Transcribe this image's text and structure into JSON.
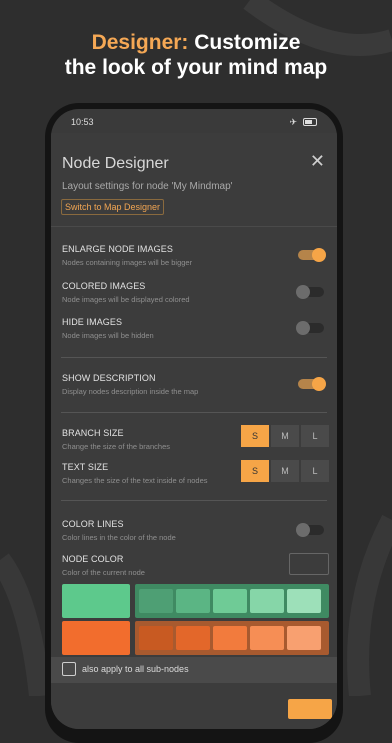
{
  "headline": {
    "accent": "Designer:",
    "line1_rest": " Customize",
    "line2": "the look of your mind map"
  },
  "status": {
    "time": "10:53",
    "airplane_icon": "airplane-icon",
    "battery_icon": "battery-icon"
  },
  "dialog": {
    "title": "Node Designer",
    "subtitle": "Layout settings for node 'My Mindmap'",
    "switch_button": "Switch to Map Designer",
    "close_icon": "close-icon"
  },
  "settings": {
    "enlarge": {
      "label": "ENLARGE NODE IMAGES",
      "desc": "Nodes containing images will be bigger",
      "on": true
    },
    "colored": {
      "label": "COLORED IMAGES",
      "desc": "Node images will be displayed colored",
      "on": false
    },
    "hide": {
      "label": "HIDE IMAGES",
      "desc": "Node images will be hidden",
      "on": false
    },
    "description": {
      "label": "SHOW DESCRIPTION",
      "desc": "Display nodes description inside the map",
      "on": true
    },
    "branch": {
      "label": "BRANCH SIZE",
      "desc": "Change the size of the branches",
      "options": [
        "S",
        "M",
        "L"
      ],
      "selected": "S"
    },
    "text": {
      "label": "TEXT SIZE",
      "desc": "Changes the size of the text inside of nodes",
      "options": [
        "S",
        "M",
        "L"
      ],
      "selected": "S"
    },
    "color_lines": {
      "label": "COLOR LINES",
      "desc": "Color lines in the color of the node",
      "on": false
    },
    "node_color": {
      "label": "NODE COLOR",
      "desc": "Color of the current node"
    }
  },
  "palette": {
    "green": {
      "main": "#5dc98c",
      "row_bg": "#3f8a62",
      "shades": [
        "#4e9f74",
        "#5bb584",
        "#6fcb96",
        "#86d6a8",
        "#9de0b9"
      ]
    },
    "orange": {
      "main": "#f26d2d",
      "row_bg": "#a85a2f",
      "shades": [
        "#c85a22",
        "#e3672a",
        "#f27b3d",
        "#f68e55",
        "#f8a070"
      ]
    }
  },
  "bottom": {
    "apply_label": "also apply to all sub-nodes",
    "checked": false
  },
  "colors": {
    "accent": "#f6a547",
    "background": "#2e2e2e",
    "dialog": "#3c3c3c"
  }
}
